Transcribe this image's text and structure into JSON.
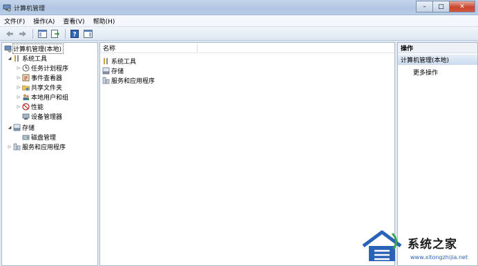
{
  "window": {
    "title": "计算机管理",
    "min_symbol": "–",
    "max_symbol": "□",
    "close_symbol": "✕"
  },
  "menu": [
    "文件(F)",
    "操作(A)",
    "查看(V)",
    "帮助(H)"
  ],
  "tree": {
    "root": "计算机管理(本地)",
    "system_tools": "系统工具",
    "task_scheduler": "任务计划程序",
    "event_viewer": "事件查看器",
    "shared_folders": "共享文件夹",
    "local_users": "本地用户和组",
    "performance": "性能",
    "device_manager": "设备管理器",
    "storage": "存储",
    "disk_management": "磁盘管理",
    "services_apps": "服务和应用程序"
  },
  "list": {
    "column_name": "名称",
    "items": [
      "系统工具",
      "存储",
      "服务和应用程序"
    ]
  },
  "actions": {
    "header": "操作",
    "section": "计算机管理(本地)",
    "more": "更多操作"
  },
  "watermark": {
    "name": "系统之家",
    "url": "www.xitongzhijia.net"
  },
  "colors": {
    "accent": "#2a62b8",
    "titlebar": "#b9cde7",
    "close": "#c9462f"
  }
}
